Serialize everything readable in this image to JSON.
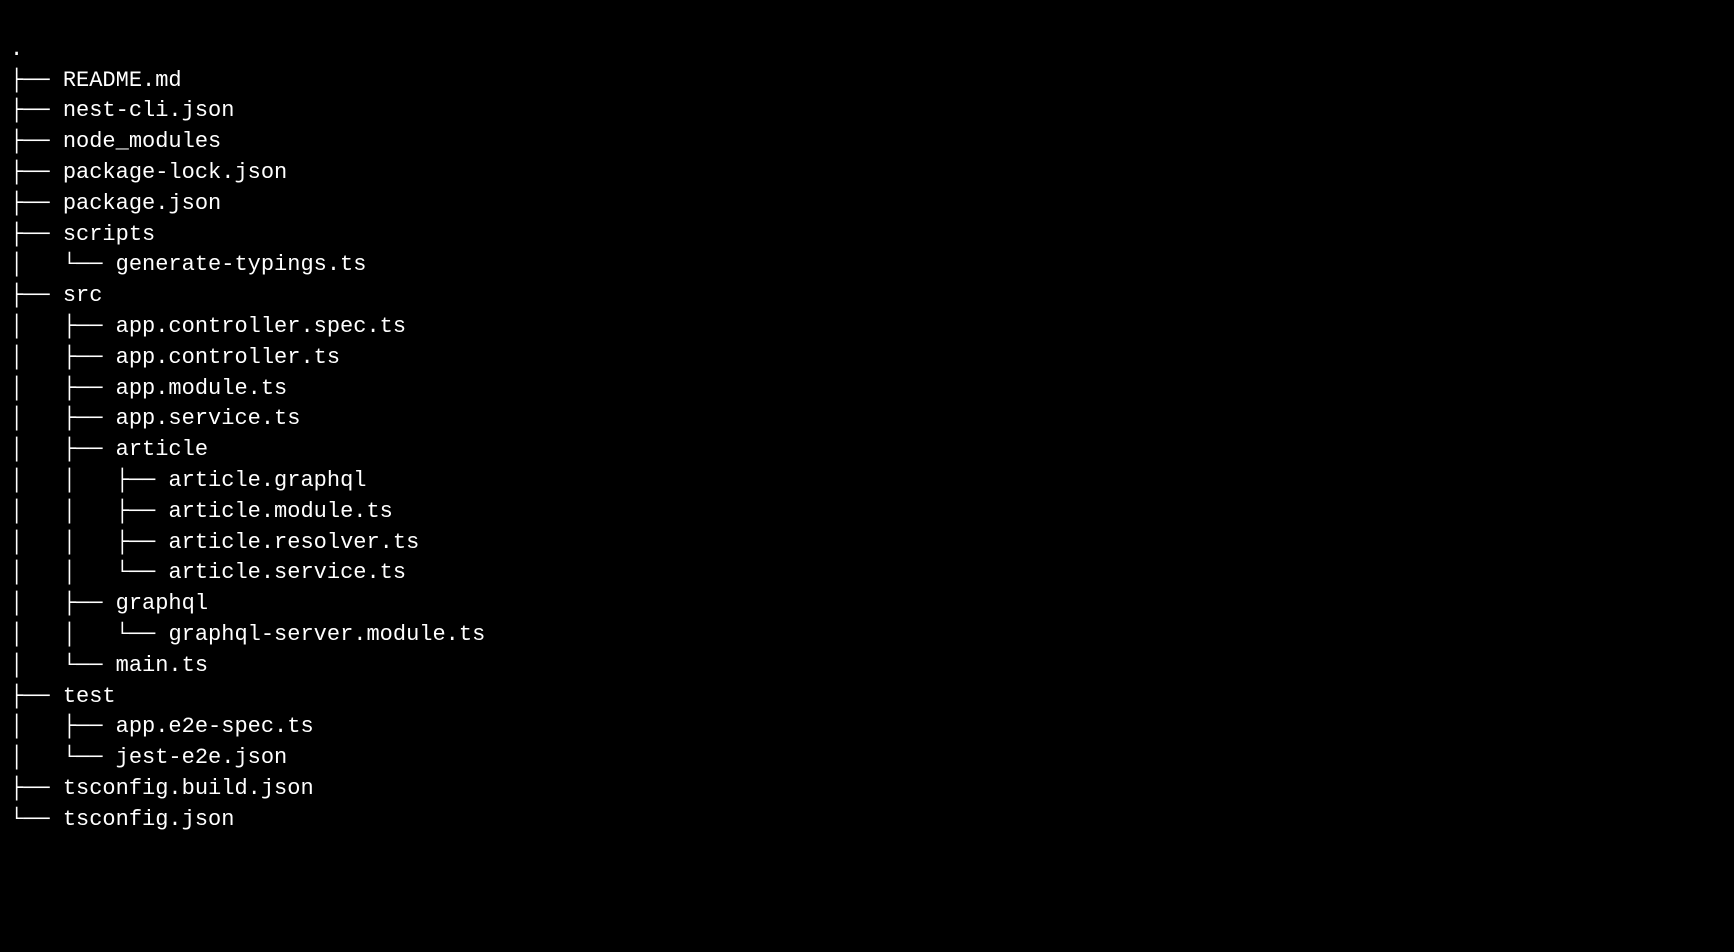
{
  "tree": {
    "root": ".",
    "lines": [
      {
        "prefix": "├── ",
        "name": "README.md"
      },
      {
        "prefix": "├── ",
        "name": "nest-cli.json"
      },
      {
        "prefix": "├── ",
        "name": "node_modules"
      },
      {
        "prefix": "├── ",
        "name": "package-lock.json"
      },
      {
        "prefix": "├── ",
        "name": "package.json"
      },
      {
        "prefix": "├── ",
        "name": "scripts"
      },
      {
        "prefix": "│   └── ",
        "name": "generate-typings.ts"
      },
      {
        "prefix": "├── ",
        "name": "src"
      },
      {
        "prefix": "│   ├── ",
        "name": "app.controller.spec.ts"
      },
      {
        "prefix": "│   ├── ",
        "name": "app.controller.ts"
      },
      {
        "prefix": "│   ├── ",
        "name": "app.module.ts"
      },
      {
        "prefix": "│   ├── ",
        "name": "app.service.ts"
      },
      {
        "prefix": "│   ├── ",
        "name": "article"
      },
      {
        "prefix": "│   │   ├── ",
        "name": "article.graphql"
      },
      {
        "prefix": "│   │   ├── ",
        "name": "article.module.ts"
      },
      {
        "prefix": "│   │   ├── ",
        "name": "article.resolver.ts"
      },
      {
        "prefix": "│   │   └── ",
        "name": "article.service.ts"
      },
      {
        "prefix": "│   ├── ",
        "name": "graphql"
      },
      {
        "prefix": "│   │   └── ",
        "name": "graphql-server.module.ts"
      },
      {
        "prefix": "│   └── ",
        "name": "main.ts"
      },
      {
        "prefix": "├── ",
        "name": "test"
      },
      {
        "prefix": "│   ├── ",
        "name": "app.e2e-spec.ts"
      },
      {
        "prefix": "│   └── ",
        "name": "jest-e2e.json"
      },
      {
        "prefix": "├── ",
        "name": "tsconfig.build.json"
      },
      {
        "prefix": "└── ",
        "name": "tsconfig.json"
      }
    ]
  }
}
